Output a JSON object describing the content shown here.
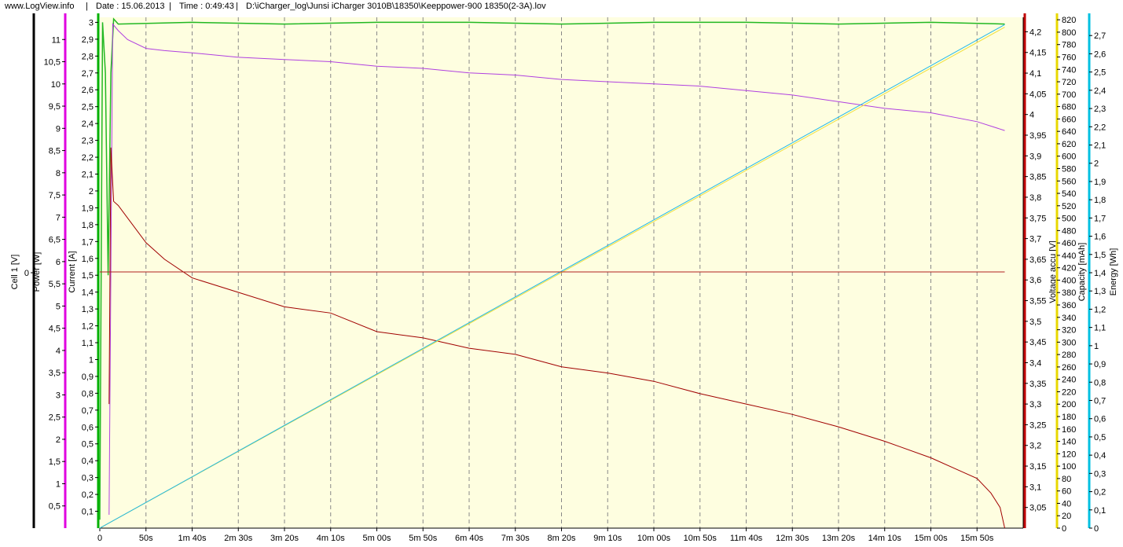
{
  "header": {
    "site": "www.LogView.info",
    "date": "Date : 15.06.2013",
    "time": "Time : 0:49:43",
    "file": "D:\\iCharger_log\\Junsi iCharger 3010B\\18350\\Keeppower-900 18350(2-3A).lov",
    "separator": "|"
  },
  "chart_data": {
    "type": "line",
    "x_ticks": [
      "0",
      "50s",
      "1m 40s",
      "2m 30s",
      "3m 20s",
      "4m 10s",
      "5m 00s",
      "5m 50s",
      "6m 40s",
      "7m 30s",
      "8m 20s",
      "9m 10s",
      "10m 00s",
      "10m 50s",
      "11m 40s",
      "12m 30s",
      "13m 20s",
      "14m 10s",
      "15m 00s",
      "15m 50s"
    ],
    "x_tick_seconds": [
      0,
      50,
      100,
      150,
      200,
      250,
      300,
      350,
      400,
      450,
      500,
      550,
      600,
      650,
      700,
      750,
      800,
      850,
      900,
      950
    ],
    "xlim": [
      0,
      1000
    ],
    "grid": "vertical dashed",
    "axes": [
      {
        "id": "cell",
        "label": "Cell 1 [V]",
        "side": "left",
        "color": "#000000",
        "ticks": [
          "0"
        ],
        "tick_values": [
          0
        ]
      },
      {
        "id": "power",
        "label": "Power [W]",
        "side": "left",
        "color": "#e000e0",
        "ylim": [
          0,
          11.5
        ],
        "ticks": [
          "0,5",
          "1",
          "1,5",
          "2",
          "2,5",
          "3",
          "3,5",
          "4",
          "4,5",
          "5",
          "5,5",
          "6",
          "6,5",
          "7",
          "7,5",
          "8",
          "8,5",
          "9",
          "9,5",
          "10",
          "10,5",
          "11"
        ],
        "tick_values": [
          0.5,
          1,
          1.5,
          2,
          2.5,
          3,
          3.5,
          4,
          4.5,
          5,
          5.5,
          6,
          6.5,
          7,
          7.5,
          8,
          8.5,
          9,
          9.5,
          10,
          10.5,
          11
        ]
      },
      {
        "id": "current",
        "label": "Current [A]",
        "side": "left",
        "color": "#00b000",
        "ylim": [
          0,
          3.03
        ],
        "ticks": [
          "0,1",
          "0,2",
          "0,3",
          "0,4",
          "0,5",
          "0,6",
          "0,7",
          "0,8",
          "0,9",
          "1",
          "1,1",
          "1,2",
          "1,3",
          "1,4",
          "1,5",
          "1,6",
          "1,7",
          "1,8",
          "1,9",
          "2",
          "2,1",
          "2,2",
          "2,3",
          "2,4",
          "2,5",
          "2,6",
          "2,7",
          "2,8",
          "2,9",
          "3"
        ],
        "tick_values": [
          0.1,
          0.2,
          0.3,
          0.4,
          0.5,
          0.6,
          0.7,
          0.8,
          0.9,
          1,
          1.1,
          1.2,
          1.3,
          1.4,
          1.5,
          1.6,
          1.7,
          1.8,
          1.9,
          2,
          2.1,
          2.2,
          2.3,
          2.4,
          2.5,
          2.6,
          2.7,
          2.8,
          2.9,
          3
        ]
      },
      {
        "id": "voltage",
        "label": "Voltage accu [V]",
        "side": "right",
        "color": "#c00000",
        "ylim": [
          3.0,
          4.235
        ],
        "ticks": [
          "3,05",
          "3,1",
          "3,15",
          "3,2",
          "3,25",
          "3,3",
          "3,35",
          "3,4",
          "3,45",
          "3,5",
          "3,55",
          "3,6",
          "3,65",
          "3,7",
          "3,75",
          "3,8",
          "3,85",
          "3,9",
          "3,95",
          "4",
          "4,05",
          "4,1",
          "4,15",
          "4,2"
        ],
        "tick_values": [
          3.05,
          3.1,
          3.15,
          3.2,
          3.25,
          3.3,
          3.35,
          3.4,
          3.45,
          3.5,
          3.55,
          3.6,
          3.65,
          3.7,
          3.75,
          3.8,
          3.85,
          3.9,
          3.95,
          4,
          4.05,
          4.1,
          4.15,
          4.2
        ]
      },
      {
        "id": "capacity",
        "label": "Capacity [mAh]",
        "side": "right",
        "color": "#e8d800",
        "ylim": [
          0,
          824
        ],
        "ticks": [
          "0",
          "20",
          "40",
          "60",
          "80",
          "100",
          "120",
          "140",
          "160",
          "180",
          "200",
          "220",
          "240",
          "260",
          "280",
          "300",
          "320",
          "340",
          "360",
          "380",
          "400",
          "420",
          "440",
          "460",
          "480",
          "500",
          "520",
          "540",
          "560",
          "580",
          "600",
          "620",
          "640",
          "660",
          "680",
          "700",
          "720",
          "740",
          "760",
          "780",
          "800",
          "820"
        ],
        "tick_values": [
          0,
          20,
          40,
          60,
          80,
          100,
          120,
          140,
          160,
          180,
          200,
          220,
          240,
          260,
          280,
          300,
          320,
          340,
          360,
          380,
          400,
          420,
          440,
          460,
          480,
          500,
          520,
          540,
          560,
          580,
          600,
          620,
          640,
          660,
          680,
          700,
          720,
          740,
          760,
          780,
          800,
          820
        ]
      },
      {
        "id": "energy",
        "label": "Energy [Wh]",
        "side": "right",
        "color": "#00c0e0",
        "ylim": [
          0,
          2.8
        ],
        "ticks": [
          "0",
          "0,1",
          "0,2",
          "0,3",
          "0,4",
          "0,5",
          "0,6",
          "0,7",
          "0,8",
          "0,9",
          "1",
          "1,1",
          "1,2",
          "1,3",
          "1,4",
          "1,5",
          "1,6",
          "1,7",
          "1,8",
          "1,9",
          "2",
          "2,1",
          "2,2",
          "2,3",
          "2,4",
          "2,5",
          "2,6",
          "2,7"
        ],
        "tick_values": [
          0,
          0.1,
          0.2,
          0.3,
          0.4,
          0.5,
          0.6,
          0.7,
          0.8,
          0.9,
          1,
          1.1,
          1.2,
          1.3,
          1.4,
          1.5,
          1.6,
          1.7,
          1.8,
          1.9,
          2,
          2.1,
          2.2,
          2.3,
          2.4,
          2.5,
          2.6,
          2.7
        ]
      }
    ],
    "series": [
      {
        "axis": "current",
        "color": "#22b822",
        "x": [
          0,
          3,
          6,
          9,
          12,
          15,
          20,
          100,
          200,
          300,
          400,
          500,
          600,
          700,
          800,
          900,
          980
        ],
        "y": [
          0.05,
          3.0,
          2.7,
          1.5,
          2.7,
          3.02,
          2.99,
          3.0,
          2.99,
          3.0,
          3.0,
          2.99,
          3.0,
          3.0,
          2.99,
          3.0,
          2.99
        ]
      },
      {
        "axis": "power",
        "color": "#b040e0",
        "x": [
          10,
          14,
          20,
          30,
          50,
          70,
          100,
          150,
          200,
          250,
          300,
          350,
          400,
          450,
          500,
          550,
          600,
          650,
          700,
          750,
          800,
          850,
          900,
          950,
          980
        ],
        "y": [
          0.3,
          11.35,
          11.2,
          11.0,
          10.8,
          10.75,
          10.7,
          10.6,
          10.55,
          10.5,
          10.4,
          10.35,
          10.25,
          10.2,
          10.1,
          10.05,
          10.0,
          9.95,
          9.85,
          9.75,
          9.6,
          9.45,
          9.35,
          9.15,
          8.95
        ]
      },
      {
        "axis": "voltage",
        "color": "#a00000",
        "x": [
          10,
          12,
          15,
          20,
          30,
          50,
          70,
          100,
          150,
          200,
          250,
          300,
          350,
          400,
          450,
          500,
          550,
          600,
          650,
          700,
          750,
          800,
          850,
          900,
          930,
          950,
          965,
          975,
          980
        ],
        "y": [
          3.3,
          3.92,
          3.79,
          3.78,
          3.75,
          3.69,
          3.65,
          3.605,
          3.57,
          3.535,
          3.52,
          3.475,
          3.46,
          3.435,
          3.42,
          3.39,
          3.375,
          3.355,
          3.325,
          3.3,
          3.275,
          3.245,
          3.21,
          3.17,
          3.14,
          3.12,
          3.085,
          3.05,
          3.0
        ]
      },
      {
        "axis": "capacity",
        "color": "#f0e040",
        "x": [
          0,
          980
        ],
        "y": [
          0,
          808
        ]
      },
      {
        "axis": "energy",
        "color": "#20b8e8",
        "x": [
          0,
          980
        ],
        "y": [
          0,
          2.76
        ]
      },
      {
        "axis": "cell",
        "color": "#b02020",
        "x": [
          0,
          980
        ],
        "y": [
          0,
          0
        ]
      }
    ]
  }
}
